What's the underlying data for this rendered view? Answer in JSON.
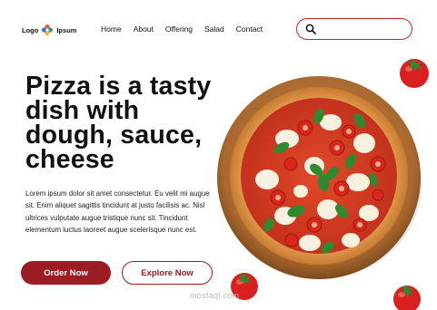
{
  "nav": {
    "logo_left": "Logo",
    "logo_right": "Ipsum",
    "links": [
      "Home",
      "About",
      "Offering",
      "Salad",
      "Contact"
    ],
    "search_placeholder": ""
  },
  "hero": {
    "headline": "Pizza is a tasty dish with dough, sauce, cheese",
    "description": "Lorem ipsum dolor sit amet consectetur. Eu velit mi augue sit. Enim aliquet sagittis tincidunt at justo facilisis ac. Nisl ultrices vulputate augue tristique nunc sit. Tincidunt elementum luctus laoreet augue scelerisque nunc est.",
    "primary_button": "Order Now",
    "secondary_button": "Explore Now"
  },
  "watermark": "mostaql.com",
  "colors": {
    "accent": "#9b1c22",
    "search_border": "#c0282e",
    "tomato": "#d91f1f",
    "board": "#b87a3d"
  },
  "icons": [
    "logo-flower-icon",
    "search-icon",
    "pizza-image",
    "tomato-image"
  ]
}
